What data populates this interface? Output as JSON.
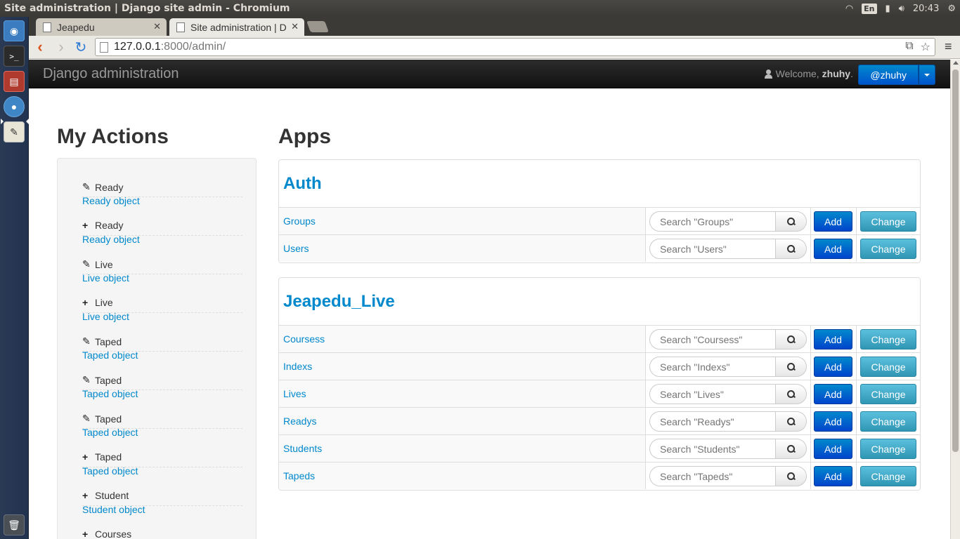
{
  "os": {
    "window_title": "Site administration | Django site admin - Chromium",
    "lang": "En",
    "time": "20:43"
  },
  "browser": {
    "tabs": [
      {
        "title": "Jeapedu",
        "active": false
      },
      {
        "title": "Site administration | D",
        "active": true
      }
    ],
    "url_host": "127.0.0.1",
    "url_rest": ":8000/admin/"
  },
  "header": {
    "brand": "Django administration",
    "welcome": "Welcome,",
    "username": "zhuhy",
    "welcome_tail": ".",
    "user_button": "@zhuhy"
  },
  "sidebar": {
    "title": "My Actions",
    "items": [
      {
        "icon": "pencil-icon",
        "glyph": "✎",
        "label": "Ready",
        "link": "Ready object"
      },
      {
        "icon": "plus-icon",
        "glyph": "+",
        "label": "Ready",
        "link": "Ready object"
      },
      {
        "icon": "pencil-icon",
        "glyph": "✎",
        "label": "Live",
        "link": "Live object"
      },
      {
        "icon": "plus-icon",
        "glyph": "+",
        "label": "Live",
        "link": "Live object"
      },
      {
        "icon": "pencil-icon",
        "glyph": "✎",
        "label": "Taped",
        "link": "Taped object"
      },
      {
        "icon": "pencil-icon",
        "glyph": "✎",
        "label": "Taped",
        "link": "Taped object"
      },
      {
        "icon": "pencil-icon",
        "glyph": "✎",
        "label": "Taped",
        "link": "Taped object"
      },
      {
        "icon": "plus-icon",
        "glyph": "+",
        "label": "Taped",
        "link": "Taped object"
      },
      {
        "icon": "plus-icon",
        "glyph": "+",
        "label": "Student",
        "link": "Student object"
      },
      {
        "icon": "plus-icon",
        "glyph": "+",
        "label": "Courses",
        "link": ""
      }
    ]
  },
  "apps": {
    "title": "Apps",
    "add_label": "Add",
    "change_label": "Change",
    "modules": [
      {
        "name": "Auth",
        "models": [
          {
            "name": "Groups",
            "placeholder": "Search \"Groups\""
          },
          {
            "name": "Users",
            "placeholder": "Search \"Users\""
          }
        ]
      },
      {
        "name": "Jeapedu_Live",
        "models": [
          {
            "name": "Coursess",
            "placeholder": "Search \"Coursess\""
          },
          {
            "name": "Indexs",
            "placeholder": "Search \"Indexs\""
          },
          {
            "name": "Lives",
            "placeholder": "Search \"Lives\""
          },
          {
            "name": "Readys",
            "placeholder": "Search \"Readys\""
          },
          {
            "name": "Students",
            "placeholder": "Search \"Students\""
          },
          {
            "name": "Tapeds",
            "placeholder": "Search \"Tapeds\""
          }
        ]
      }
    ]
  }
}
